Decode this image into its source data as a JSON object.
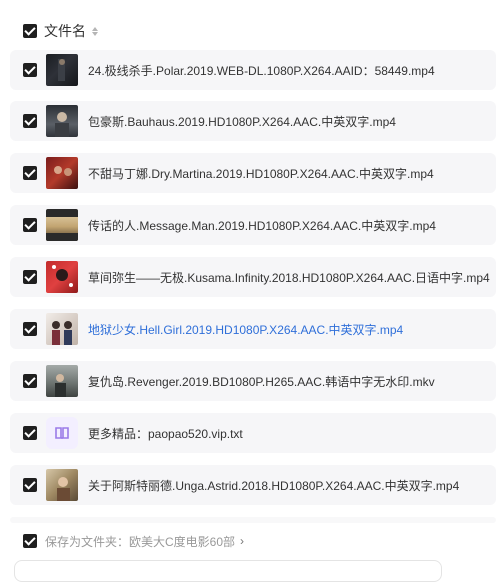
{
  "header": {
    "title": "文件名"
  },
  "files": [
    {
      "name": "24.极线杀手.Polar.2019.WEB-DL.1080P.X264.AAID：58449.mp4",
      "thumb": "film-thumb-polar",
      "highlight": false
    },
    {
      "name": "包豪斯.Bauhaus.2019.HD1080P.X264.AAC.中英双字.mp4",
      "thumb": "film-thumb-bauhaus",
      "highlight": false
    },
    {
      "name": "不甜马丁娜.Dry.Martina.2019.HD1080P.X264.AAC.中英双字.mp4",
      "thumb": "film-thumb-dry-martina",
      "highlight": false
    },
    {
      "name": "传话的人.Message.Man.2019.HD1080P.X264.AAC.中英双字.mp4",
      "thumb": "film-thumb-message-man",
      "highlight": false
    },
    {
      "name": "草间弥生——无极.Kusama.Infinity.2018.HD1080P.X264.AAC.日语中字.mp4",
      "thumb": "film-thumb-kusama",
      "highlight": false
    },
    {
      "name": "地狱少女.Hell.Girl.2019.HD1080P.X264.AAC.中英双字.mp4",
      "thumb": "film-thumb-hell-girl",
      "highlight": true
    },
    {
      "name": "复仇岛.Revenger.2019.BD1080P.H265.AAC.韩语中字无水印.mkv",
      "thumb": "film-thumb-revenger",
      "highlight": false
    },
    {
      "name": "更多精品：paopao520.vip.txt",
      "thumb": "text-file-icon",
      "highlight": false
    },
    {
      "name": "关于阿斯特丽德.Unga.Astrid.2018.HD1080P.X264.AAC.中英双字.mp4",
      "thumb": "film-thumb-unga-astrid",
      "highlight": false
    }
  ],
  "footer": {
    "save_label": "保存为文件夹：欧美大C度电影60部",
    "chevron": "›"
  },
  "colors": {
    "accent": "#2f6fd9",
    "checkbox": "#1f1f1f",
    "row_bg": "#f6f6f8"
  }
}
